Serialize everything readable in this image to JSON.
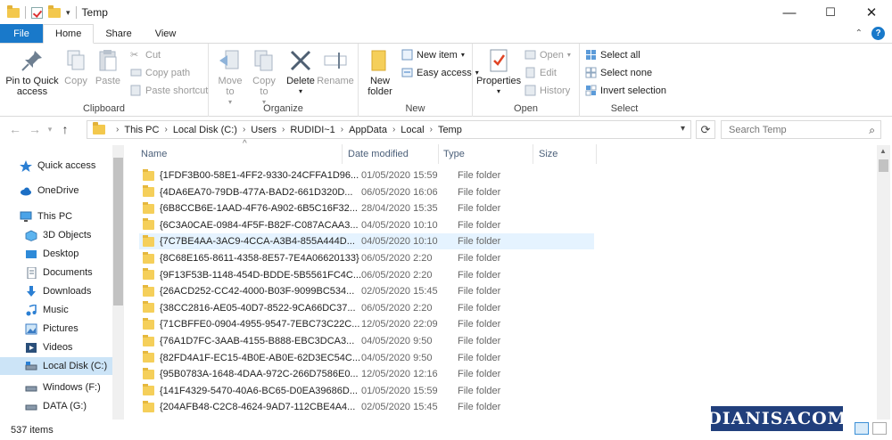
{
  "window": {
    "title": "Temp",
    "controls": [
      "—",
      "☐",
      "✕"
    ]
  },
  "ribbon_tabs": {
    "file": "File",
    "home": "Home",
    "share": "Share",
    "view": "View",
    "collapse": "⌃",
    "help": "?"
  },
  "ribbon": {
    "clipboard": {
      "label": "Clipboard",
      "pin": "Pin to Quick access",
      "copy": "Copy",
      "paste": "Paste",
      "cut": "Cut",
      "copy_path": "Copy path",
      "paste_shortcut": "Paste shortcut"
    },
    "organize": {
      "label": "Organize",
      "move_to": "Move to",
      "copy_to": "Copy to",
      "delete": "Delete",
      "rename": "Rename"
    },
    "new": {
      "label": "New",
      "new_folder": "New folder",
      "new_item": "New item",
      "easy_access": "Easy access"
    },
    "open": {
      "label": "Open",
      "properties": "Properties",
      "open": "Open",
      "edit": "Edit",
      "history": "History"
    },
    "select": {
      "label": "Select",
      "select_all": "Select all",
      "select_none": "Select none",
      "invert": "Invert selection"
    }
  },
  "address": {
    "crumbs": [
      "This PC",
      "Local Disk (C:)",
      "Users",
      "RUDIDI~1",
      "AppData",
      "Local",
      "Temp"
    ]
  },
  "search": {
    "placeholder": "Search Temp"
  },
  "nav": [
    {
      "label": "Quick access",
      "icon": "star-icon"
    },
    {
      "label": "OneDrive",
      "icon": "cloud-icon"
    },
    {
      "label": "This PC",
      "icon": "pc-icon"
    },
    {
      "label": "3D Objects",
      "icon": "cube-icon"
    },
    {
      "label": "Desktop",
      "icon": "desktop-icon"
    },
    {
      "label": "Documents",
      "icon": "documents-icon"
    },
    {
      "label": "Downloads",
      "icon": "download-icon"
    },
    {
      "label": "Music",
      "icon": "music-icon"
    },
    {
      "label": "Pictures",
      "icon": "pictures-icon"
    },
    {
      "label": "Videos",
      "icon": "videos-icon"
    },
    {
      "label": "Local Disk (C:)",
      "icon": "drive-icon"
    },
    {
      "label": "Windows (F:)",
      "icon": "drive-icon"
    },
    {
      "label": "DATA (G:)",
      "icon": "drive-icon"
    }
  ],
  "columns": {
    "name": "Name",
    "date": "Date modified",
    "type": "Type",
    "size": "Size"
  },
  "files": [
    {
      "name": "{1FDF3B00-58E1-4FF2-9330-24CFFA1D96...",
      "date": "01/05/2020 15:59",
      "type": "File folder"
    },
    {
      "name": "{4DA6EA70-79DB-477A-BAD2-661D320D...",
      "date": "06/05/2020 16:06",
      "type": "File folder"
    },
    {
      "name": "{6B8CCB6E-1AAD-4F76-A902-6B5C16F32...",
      "date": "28/04/2020 15:35",
      "type": "File folder"
    },
    {
      "name": "{6C3A0CAE-0984-4F5F-B82F-C087ACAA3...",
      "date": "04/05/2020 10:10",
      "type": "File folder"
    },
    {
      "name": "{7C7BE4AA-3AC9-4CCA-A3B4-855A444D...",
      "date": "04/05/2020 10:10",
      "type": "File folder"
    },
    {
      "name": "{8C68E165-8611-4358-8E57-7E4A06620133}",
      "date": "06/05/2020 2:20",
      "type": "File folder"
    },
    {
      "name": "{9F13F53B-1148-454D-BDDE-5B5561FC4C...",
      "date": "06/05/2020 2:20",
      "type": "File folder"
    },
    {
      "name": "{26ACD252-CC42-4000-B03F-9099BC534...",
      "date": "02/05/2020 15:45",
      "type": "File folder"
    },
    {
      "name": "{38CC2816-AE05-40D7-8522-9CA66DC37...",
      "date": "06/05/2020 2:20",
      "type": "File folder"
    },
    {
      "name": "{71CBFFE0-0904-4955-9547-7EBC73C22C...",
      "date": "12/05/2020 22:09",
      "type": "File folder"
    },
    {
      "name": "{76A1D7FC-3AAB-4155-B888-EBC3DCA3...",
      "date": "04/05/2020 9:50",
      "type": "File folder"
    },
    {
      "name": "{82FD4A1F-EC15-4B0E-AB0E-62D3EC54C...",
      "date": "04/05/2020 9:50",
      "type": "File folder"
    },
    {
      "name": "{95B0783A-1648-4DAA-972C-266D7586E0...",
      "date": "12/05/2020 12:16",
      "type": "File folder"
    },
    {
      "name": "{141F4329-5470-40A6-BC65-D0EA39686D...",
      "date": "01/05/2020 15:59",
      "type": "File folder"
    },
    {
      "name": "{204AFB48-C2C8-4624-9AD7-112CBE4A4...",
      "date": "02/05/2020 15:45",
      "type": "File folder"
    }
  ],
  "status": {
    "count": "537 items"
  },
  "watermark": "DIANISACOM",
  "colors": {
    "accent": "#1979ca",
    "folder": "#f5cf5a",
    "selection": "#cce4f7",
    "watermark_bg": "#213f7c"
  }
}
